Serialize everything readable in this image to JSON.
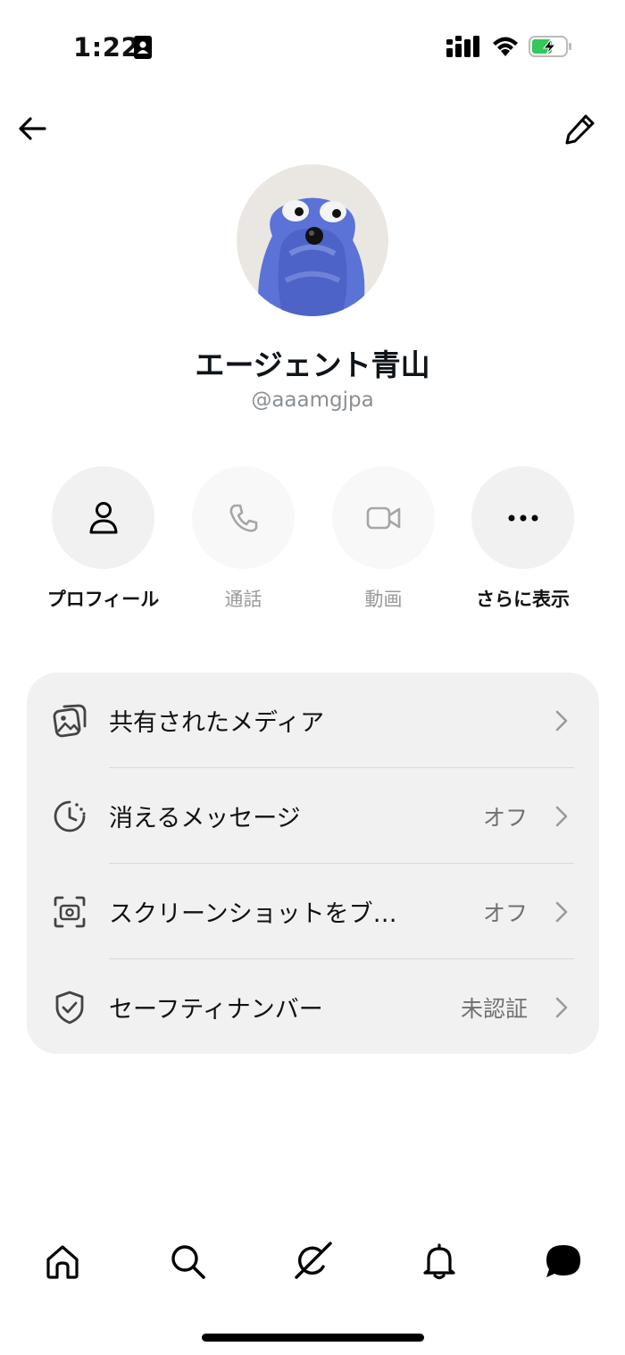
{
  "status_bar": {
    "time": "1:22"
  },
  "profile": {
    "display_name": "エージェント青山",
    "handle": "@aaamgjpa"
  },
  "actions": [
    {
      "label": "プロフィール",
      "icon": "person-icon",
      "enabled": true
    },
    {
      "label": "通話",
      "icon": "phone-icon",
      "enabled": false
    },
    {
      "label": "動画",
      "icon": "video-camera-icon",
      "enabled": false
    },
    {
      "label": "さらに表示",
      "icon": "more-dots-icon",
      "enabled": true
    }
  ],
  "settings": [
    {
      "label": "共有されたメディア",
      "value": "",
      "icon": "media-gallery-icon"
    },
    {
      "label": "消えるメッセージ",
      "value": "オフ",
      "icon": "timer-clock-icon"
    },
    {
      "label": "スクリーンショットをブ…",
      "value": "オフ",
      "icon": "screenshot-camera-icon"
    },
    {
      "label": "セーフティナンバー",
      "value": "未認証",
      "icon": "shield-check-icon"
    }
  ],
  "tab_bar": [
    "home-icon",
    "search-icon",
    "grok-icon",
    "notifications-bell-icon",
    "messages-icon"
  ]
}
